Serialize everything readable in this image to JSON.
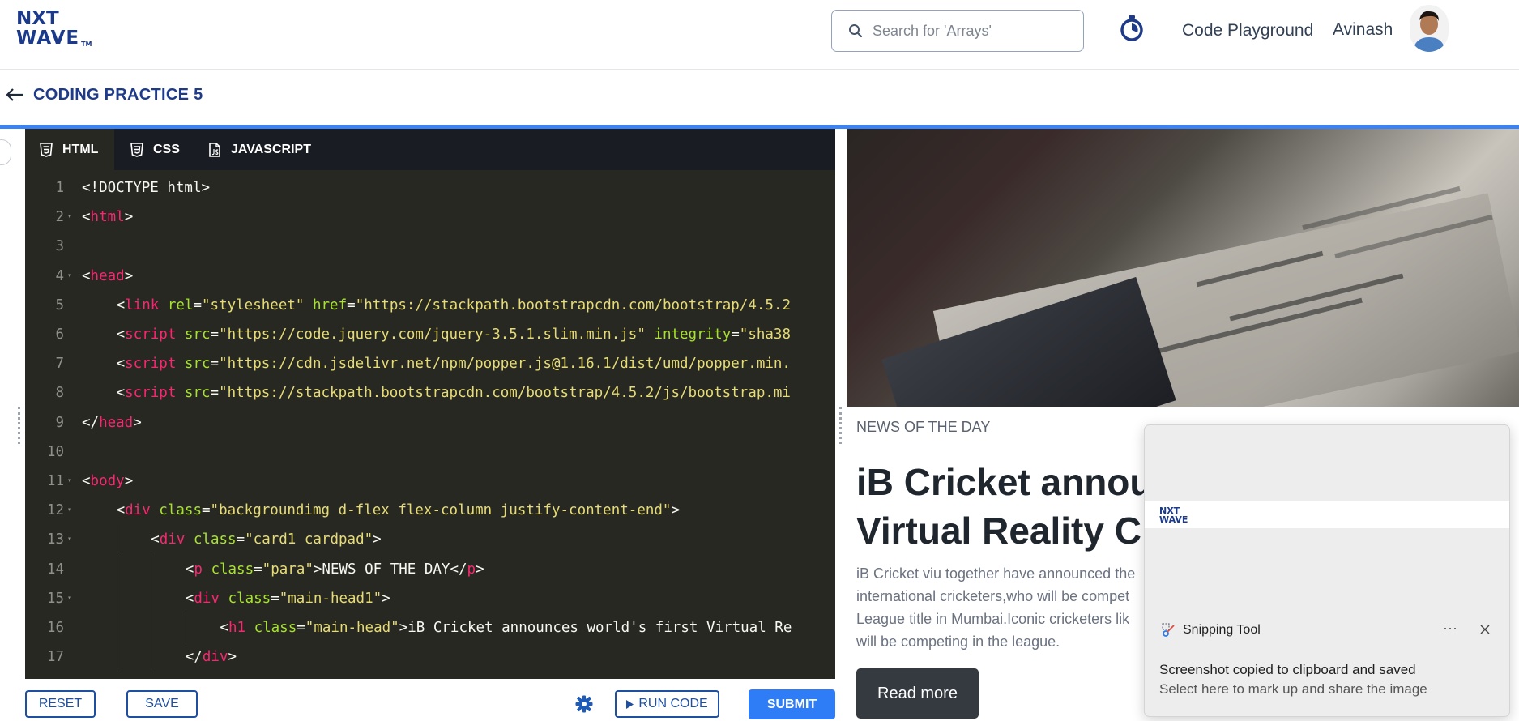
{
  "header": {
    "logo_line1": "NXT",
    "logo_line2": "WAVE",
    "logo_tm": "TM",
    "search_placeholder": "Search for 'Arrays'",
    "nav_link": "Code Playground",
    "user_name": "Avinash"
  },
  "subheader": {
    "title": "CODING PRACTICE 5"
  },
  "editor": {
    "tabs": [
      {
        "label": "HTML",
        "icon": "html5-icon"
      },
      {
        "label": "CSS",
        "icon": "css3-icon"
      },
      {
        "label": "JAVASCRIPT",
        "icon": "js-file-icon"
      }
    ],
    "lines": [
      {
        "n": "1",
        "fold": "",
        "indent": 0,
        "tokens": [
          [
            "plain",
            "<!DOCTYPE html>"
          ]
        ]
      },
      {
        "n": "2",
        "fold": "▾",
        "indent": 0,
        "tokens": [
          [
            "plain",
            "<"
          ],
          [
            "tag",
            "html"
          ],
          [
            "plain",
            ">"
          ]
        ]
      },
      {
        "n": "3",
        "fold": "",
        "indent": 0,
        "tokens": []
      },
      {
        "n": "4",
        "fold": "▾",
        "indent": 0,
        "tokens": [
          [
            "plain",
            "<"
          ],
          [
            "tag",
            "head"
          ],
          [
            "plain",
            ">"
          ]
        ]
      },
      {
        "n": "5",
        "fold": "",
        "indent": 1,
        "tokens": [
          [
            "plain",
            "<"
          ],
          [
            "tag",
            "link"
          ],
          [
            "plain",
            " "
          ],
          [
            "attr",
            "rel"
          ],
          [
            "plain",
            "="
          ],
          [
            "str",
            "\"stylesheet\""
          ],
          [
            "plain",
            " "
          ],
          [
            "attr",
            "href"
          ],
          [
            "plain",
            "="
          ],
          [
            "str",
            "\"https://stackpath.bootstrapcdn.com/bootstrap/4.5.2"
          ]
        ]
      },
      {
        "n": "6",
        "fold": "",
        "indent": 1,
        "tokens": [
          [
            "plain",
            "<"
          ],
          [
            "tag",
            "script"
          ],
          [
            "plain",
            " "
          ],
          [
            "attr",
            "src"
          ],
          [
            "plain",
            "="
          ],
          [
            "str",
            "\"https://code.jquery.com/jquery-3.5.1.slim.min.js\""
          ],
          [
            "plain",
            " "
          ],
          [
            "attr",
            "integrity"
          ],
          [
            "plain",
            "="
          ],
          [
            "str",
            "\"sha38"
          ]
        ]
      },
      {
        "n": "7",
        "fold": "",
        "indent": 1,
        "tokens": [
          [
            "plain",
            "<"
          ],
          [
            "tag",
            "script"
          ],
          [
            "plain",
            " "
          ],
          [
            "attr",
            "src"
          ],
          [
            "plain",
            "="
          ],
          [
            "str",
            "\"https://cdn.jsdelivr.net/npm/popper.js@1.16.1/dist/umd/popper.min."
          ]
        ]
      },
      {
        "n": "8",
        "fold": "",
        "indent": 1,
        "tokens": [
          [
            "plain",
            "<"
          ],
          [
            "tag",
            "script"
          ],
          [
            "plain",
            " "
          ],
          [
            "attr",
            "src"
          ],
          [
            "plain",
            "="
          ],
          [
            "str",
            "\"https://stackpath.bootstrapcdn.com/bootstrap/4.5.2/js/bootstrap.mi"
          ]
        ]
      },
      {
        "n": "9",
        "fold": "",
        "indent": 0,
        "tokens": [
          [
            "plain",
            "</"
          ],
          [
            "tag",
            "head"
          ],
          [
            "plain",
            ">"
          ]
        ]
      },
      {
        "n": "10",
        "fold": "",
        "indent": 0,
        "tokens": []
      },
      {
        "n": "11",
        "fold": "▾",
        "indent": 0,
        "tokens": [
          [
            "plain",
            "<"
          ],
          [
            "tag",
            "body"
          ],
          [
            "plain",
            ">"
          ]
        ]
      },
      {
        "n": "12",
        "fold": "▾",
        "indent": 1,
        "tokens": [
          [
            "plain",
            "<"
          ],
          [
            "tag",
            "div"
          ],
          [
            "plain",
            " "
          ],
          [
            "attr",
            "class"
          ],
          [
            "plain",
            "="
          ],
          [
            "str",
            "\"backgroundimg d-flex flex-column justify-content-end\""
          ],
          [
            "plain",
            ">"
          ]
        ]
      },
      {
        "n": "13",
        "fold": "▾",
        "indent": 2,
        "tokens": [
          [
            "plain",
            "<"
          ],
          [
            "tag",
            "div"
          ],
          [
            "plain",
            " "
          ],
          [
            "attr",
            "class"
          ],
          [
            "plain",
            "="
          ],
          [
            "str",
            "\"card1 cardpad\""
          ],
          [
            "plain",
            ">"
          ]
        ]
      },
      {
        "n": "14",
        "fold": "",
        "indent": 3,
        "tokens": [
          [
            "plain",
            "<"
          ],
          [
            "tag",
            "p"
          ],
          [
            "plain",
            " "
          ],
          [
            "attr",
            "class"
          ],
          [
            "plain",
            "="
          ],
          [
            "str",
            "\"para\""
          ],
          [
            "plain",
            ">NEWS OF THE DAY</"
          ],
          [
            "tag",
            "p"
          ],
          [
            "plain",
            ">"
          ]
        ]
      },
      {
        "n": "15",
        "fold": "▾",
        "indent": 3,
        "tokens": [
          [
            "plain",
            "<"
          ],
          [
            "tag",
            "div"
          ],
          [
            "plain",
            " "
          ],
          [
            "attr",
            "class"
          ],
          [
            "plain",
            "="
          ],
          [
            "str",
            "\"main-head1\""
          ],
          [
            "plain",
            ">"
          ]
        ]
      },
      {
        "n": "16",
        "fold": "",
        "indent": 4,
        "tokens": [
          [
            "plain",
            "<"
          ],
          [
            "tag",
            "h1"
          ],
          [
            "plain",
            " "
          ],
          [
            "attr",
            "class"
          ],
          [
            "plain",
            "="
          ],
          [
            "str",
            "\"main-head\""
          ],
          [
            "plain",
            ">iB Cricket announces world's first Virtual Re"
          ]
        ]
      },
      {
        "n": "17",
        "fold": "",
        "indent": 3,
        "tokens": [
          [
            "plain",
            "</"
          ],
          [
            "tag",
            "div"
          ],
          [
            "plain",
            ">"
          ]
        ]
      }
    ]
  },
  "toolbar": {
    "reset_label": "RESET",
    "save_label": "SAVE",
    "run_label": "RUN CODE",
    "submit_label": "SUBMIT"
  },
  "preview": {
    "news_label": "NEWS OF THE DAY",
    "headline": "iB Cricket annou\nVirtual Reality C",
    "body": "iB Cricket viu together have announced the\ninternational cricketers,who will be compet\nLeague title in Mumbai.Iconic cricketers lik\nwill be competing in the league.",
    "read_more_label": "Read more"
  },
  "toast": {
    "app_name": "Snipping Tool",
    "more": "···",
    "title": "Screenshot copied to clipboard and saved",
    "subtitle": "Select here to mark up and share the image",
    "thumb_logo_line1": "NXT",
    "thumb_logo_line2": "WAVE"
  },
  "colors": {
    "brand": "#1b3a8b",
    "accent": "#3b82f6",
    "editor_bg": "#272822",
    "tag": "#f92672",
    "attr": "#a6e22e",
    "string": "#e6db74"
  }
}
